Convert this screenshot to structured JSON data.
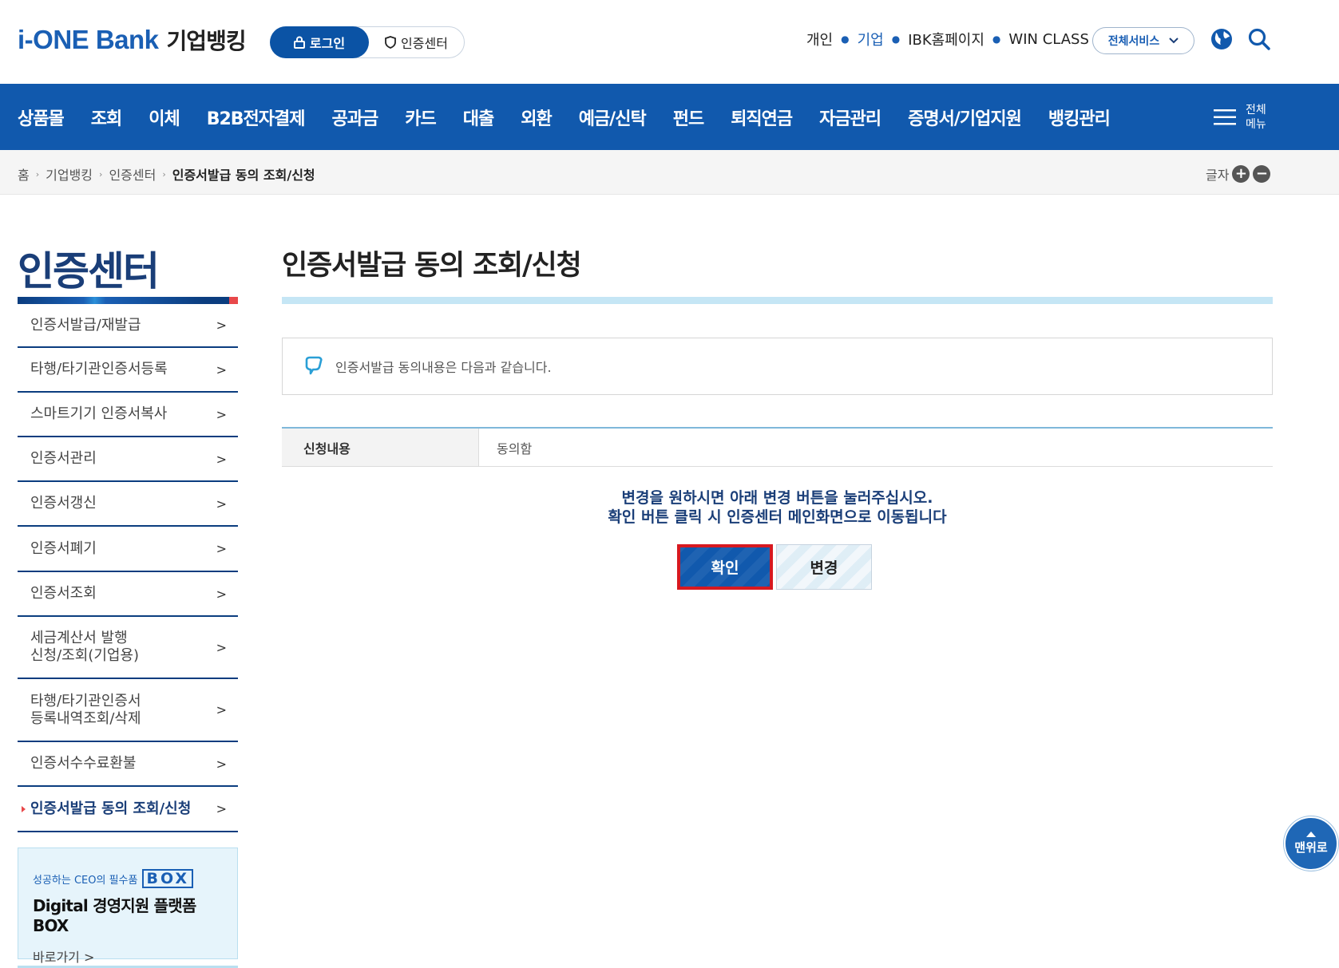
{
  "header": {
    "logo_main": "i-ONE Bank",
    "logo_sub": "기업뱅킹",
    "login_label": "로그인",
    "cert_center_label": "인증센터",
    "top_links": [
      "개인",
      "기업",
      "IBK홈페이지",
      "WIN CLASS"
    ],
    "active_top_link": "기업",
    "all_services_label": "전체서비스"
  },
  "gnb": {
    "items": [
      "상품몰",
      "조회",
      "이체",
      "B2B전자결제",
      "공과금",
      "카드",
      "대출",
      "외환",
      "예금/신탁",
      "펀드",
      "퇴직연금",
      "자금관리",
      "증명서/기업지원",
      "뱅킹관리"
    ],
    "all_menu_line1": "전체",
    "all_menu_line2": "메뉴"
  },
  "breadcrumb": {
    "items": [
      "홈",
      "기업뱅킹",
      "인증센터"
    ],
    "current": "인증서발급 동의 조회/신청",
    "font_size_label": "글자"
  },
  "lnb": {
    "title": "인증센터",
    "items": [
      {
        "label": "인증서발급/재발급"
      },
      {
        "label": "타행/타기관인증서등록"
      },
      {
        "label": "스마트기기 인증서복사"
      },
      {
        "label": "인증서관리"
      },
      {
        "label": "인증서갱신"
      },
      {
        "label": "인증서폐기"
      },
      {
        "label": "인증서조회"
      },
      {
        "label": "세금계산서 발행\n신청/조회(기업용)"
      },
      {
        "label": "타행/타기관인증서\n등록내역조회/삭제"
      },
      {
        "label": "인증서수수료환불"
      },
      {
        "label": "인증서발급 동의 조회/신청"
      }
    ],
    "current_index": 10
  },
  "banner": {
    "top_text": "성공하는 CEO의 필수품",
    "box_text": "BOX",
    "main_text": "Digital 경영지원 플랫폼 BOX",
    "link_text": "바로가기 >"
  },
  "content": {
    "page_title": "인증서발급 동의 조회/신청",
    "notice": "인증서발급 동의내용은 다음과 같습니다.",
    "table": {
      "header": "신청내용",
      "value": "동의함"
    },
    "guide_line1": "변경을 원하시면 아래 변경 버튼을 눌러주십시오.",
    "guide_line2": "확인 버튼 클릭 시 인증센터 메인화면으로 이동됩니다",
    "ok_label": "확인",
    "change_label": "변경"
  },
  "to_top_label": "맨위로",
  "colors": {
    "primary": "#1159ad",
    "navy": "#1a3e78",
    "highlight": "#d71920"
  }
}
